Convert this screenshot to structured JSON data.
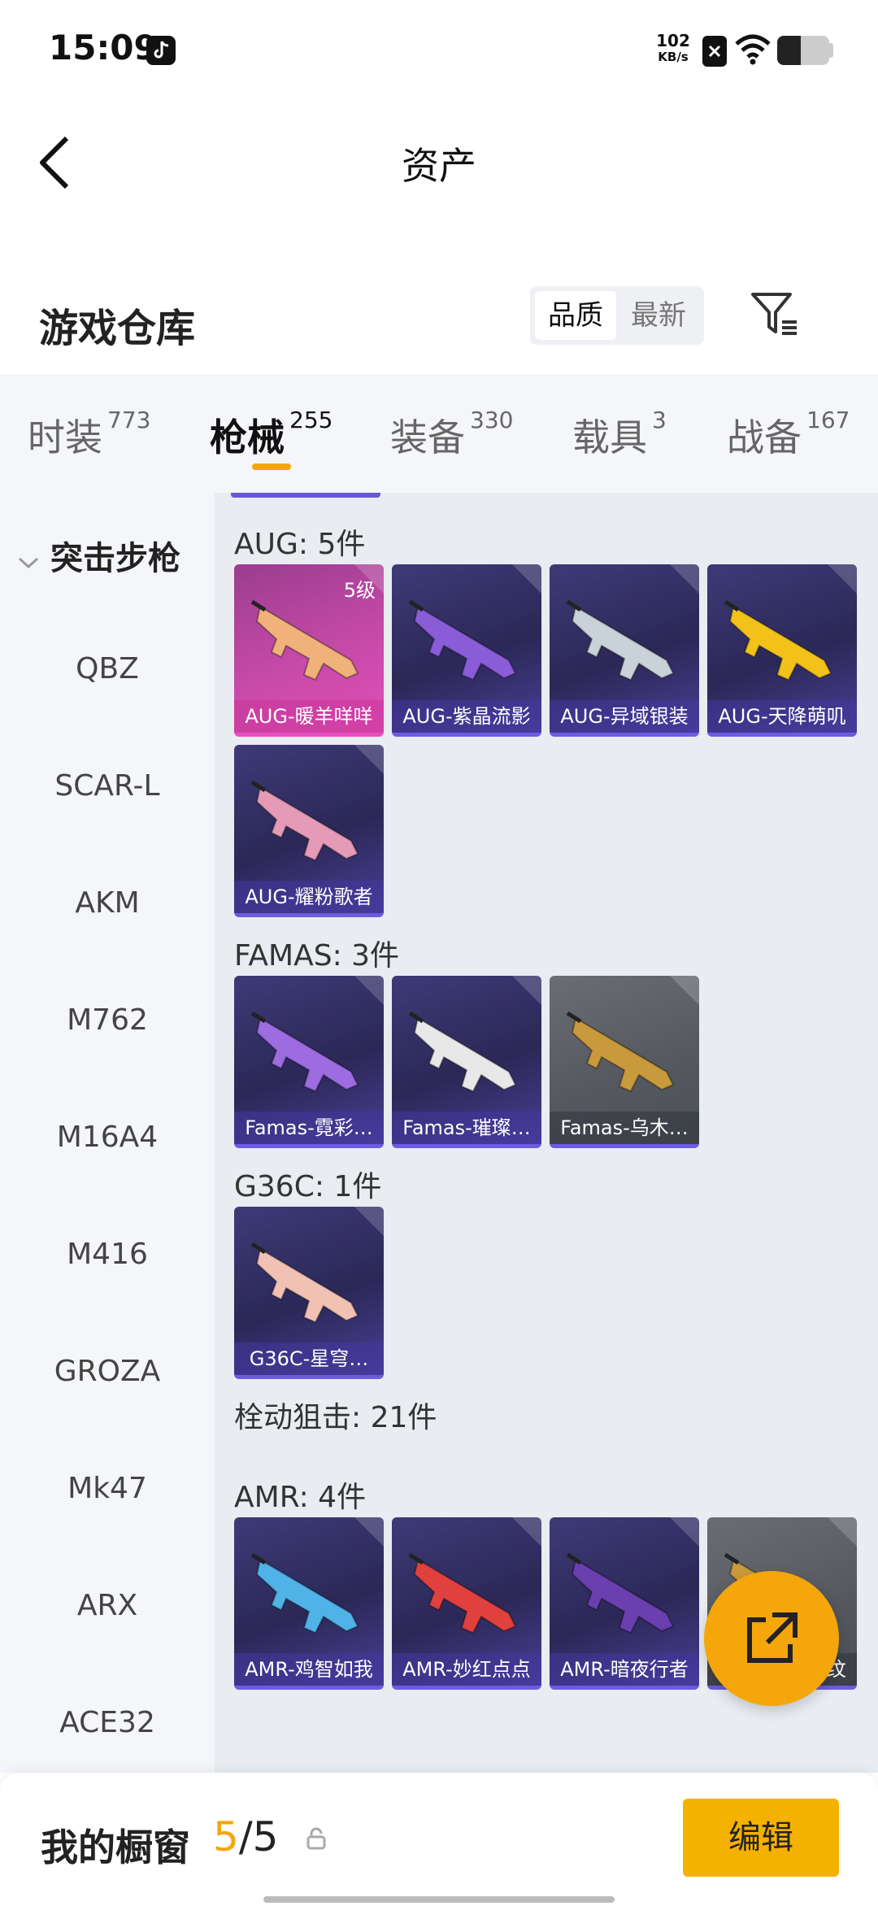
{
  "status_bar": {
    "time": "15:09",
    "net_speed_value": "102",
    "net_speed_unit": "KB/s",
    "battery_level": 0.45,
    "icons": [
      "tiktok-icon",
      "sim-disabled-icon",
      "wifi-icon",
      "battery-icon"
    ]
  },
  "header": {
    "title": "资产",
    "back_icon": "chevron-left-icon"
  },
  "warehouse": {
    "title": "游戏仓库",
    "sort_options": [
      "品质",
      "最新"
    ],
    "sort_selected": "品质",
    "filter_icon": "filter-icon"
  },
  "category_tabs": [
    {
      "label": "时装",
      "count": "773"
    },
    {
      "label": "枪械",
      "count": "255"
    },
    {
      "label": "装备",
      "count": "330"
    },
    {
      "label": "载具",
      "count": "3"
    },
    {
      "label": "战备",
      "count": "167"
    }
  ],
  "active_tab": "枪械",
  "sidebar": {
    "group": "突击步枪",
    "items": [
      "QBZ",
      "SCAR-L",
      "AKM",
      "M762",
      "M16A4",
      "M416",
      "GROZA",
      "Mk47",
      "ARX",
      "ACE32"
    ]
  },
  "groups": [
    {
      "title": "AUG: 5件",
      "cards": [
        {
          "name": "AUG-暖羊咩咩",
          "level": "5级",
          "rarity": "pink",
          "color": "#f0b27a"
        },
        {
          "name": "AUG-紫晶流影",
          "level": "",
          "rarity": "purple",
          "color": "#8a5cd8"
        },
        {
          "name": "AUG-异域银装",
          "level": "",
          "rarity": "purple",
          "color": "#c9d2d8"
        },
        {
          "name": "AUG-天降萌叽",
          "level": "",
          "rarity": "purple",
          "color": "#f2c21b"
        },
        {
          "name": "AUG-耀粉歌者",
          "level": "",
          "rarity": "purple",
          "color": "#e59bb7"
        }
      ]
    },
    {
      "title": "FAMAS: 3件",
      "cards": [
        {
          "name": "Famas-霓彩…",
          "level": "",
          "rarity": "purple",
          "color": "#9d6ce0"
        },
        {
          "name": "Famas-璀璨…",
          "level": "",
          "rarity": "purple",
          "color": "#e8e8e8"
        },
        {
          "name": "Famas-乌木…",
          "level": "",
          "rarity": "grey",
          "color": "#c99a3b"
        }
      ]
    },
    {
      "title": "G36C: 1件",
      "cards": [
        {
          "name": "G36C-星穹…",
          "level": "",
          "rarity": "purple",
          "color": "#f1c2b4"
        }
      ]
    },
    {
      "title": "栓动狙击: 21件",
      "cards": []
    },
    {
      "title": "AMR: 4件",
      "cards": [
        {
          "name": "AMR-鸡智如我",
          "level": "",
          "rarity": "purple",
          "color": "#4fb3e8"
        },
        {
          "name": "AMR-妙红点点",
          "level": "",
          "rarity": "purple",
          "color": "#e0413f"
        },
        {
          "name": "AMR-暗夜行者",
          "level": "",
          "rarity": "purple",
          "color": "#6b3fb0"
        },
        {
          "name": "AMR-乌木金纹",
          "level": "",
          "rarity": "grey",
          "color": "#c99a3b"
        }
      ]
    }
  ],
  "fab_icon": "share-external-icon",
  "bottom_bar": {
    "label": "我的橱窗",
    "current": "5",
    "separator": "/",
    "total": "5",
    "lock_icon": "unlock-icon",
    "edit_label": "编辑"
  },
  "colors": {
    "accent": "#f5a60a",
    "purple_rarity": "#6d5be3",
    "pink_rarity": "#e74fc2"
  }
}
